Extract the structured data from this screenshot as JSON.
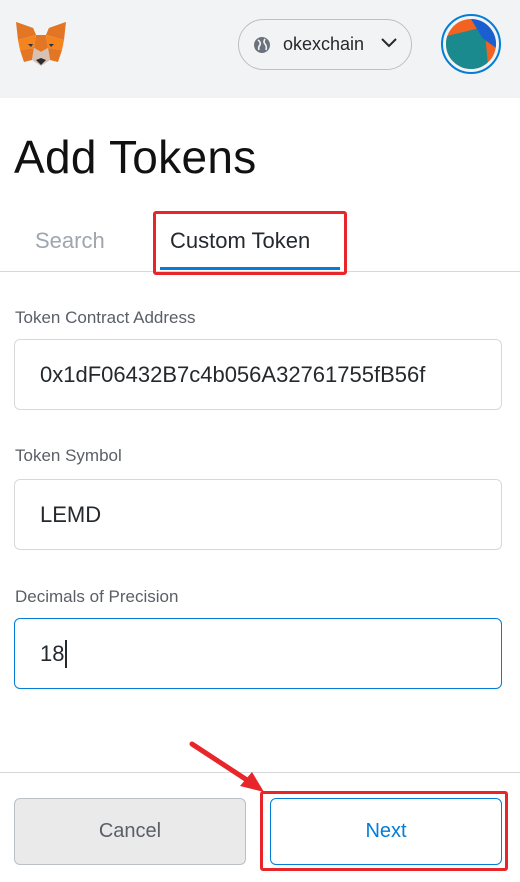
{
  "header": {
    "logo_icon": "metamask-fox-icon",
    "network": {
      "name": "okexchain",
      "icon": "globe-icon"
    },
    "account_avatar": "account-avatar"
  },
  "page": {
    "title": "Add Tokens"
  },
  "tabs": [
    {
      "label": "Search",
      "active": false
    },
    {
      "label": "Custom Token",
      "active": true
    }
  ],
  "form": {
    "contract_address": {
      "label": "Token Contract Address",
      "value": "0x1dF06432B7c4b056A32761755fB56f"
    },
    "symbol": {
      "label": "Token Symbol",
      "value": "LEMD"
    },
    "decimals": {
      "label": "Decimals of Precision",
      "value": "18"
    }
  },
  "footer": {
    "cancel_label": "Cancel",
    "next_label": "Next"
  },
  "colors": {
    "accent": "#037dd6",
    "highlight": "#e8252a",
    "topbar": "#f2f3f4"
  }
}
